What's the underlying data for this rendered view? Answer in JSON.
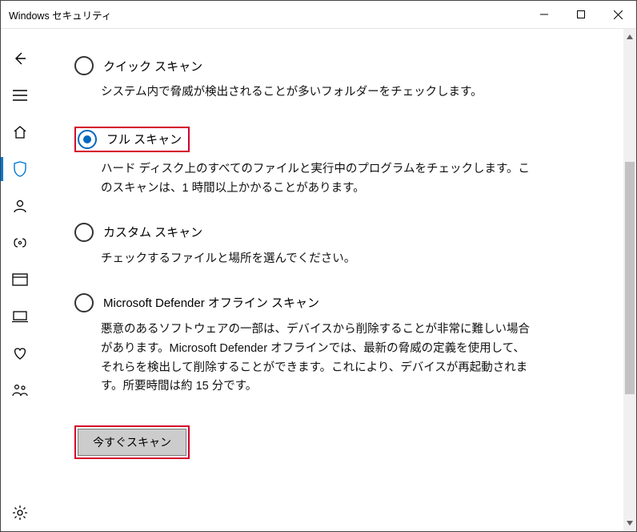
{
  "window": {
    "title": "Windows セキュリティ"
  },
  "options": {
    "quick": {
      "label": "クイック スキャン",
      "desc": "システム内で脅威が検出されることが多いフォルダーをチェックします。"
    },
    "full": {
      "label": "フル スキャン",
      "desc": "ハード ディスク上のすべてのファイルと実行中のプログラムをチェックします。このスキャンは、1 時間以上かかることがあります。"
    },
    "custom": {
      "label": "カスタム スキャン",
      "desc": "チェックするファイルと場所を選んでください。"
    },
    "offline": {
      "label": "Microsoft Defender オフライン スキャン",
      "desc": "悪意のあるソフトウェアの一部は、デバイスから削除することが非常に難しい場合があります。Microsoft Defender オフラインでは、最新の脅威の定義を使用して、それらを検出して削除することができます。これにより、デバイスが再起動されます。所要時間は約 15 分です。"
    }
  },
  "buttons": {
    "scan_now": "今すぐスキャン"
  }
}
